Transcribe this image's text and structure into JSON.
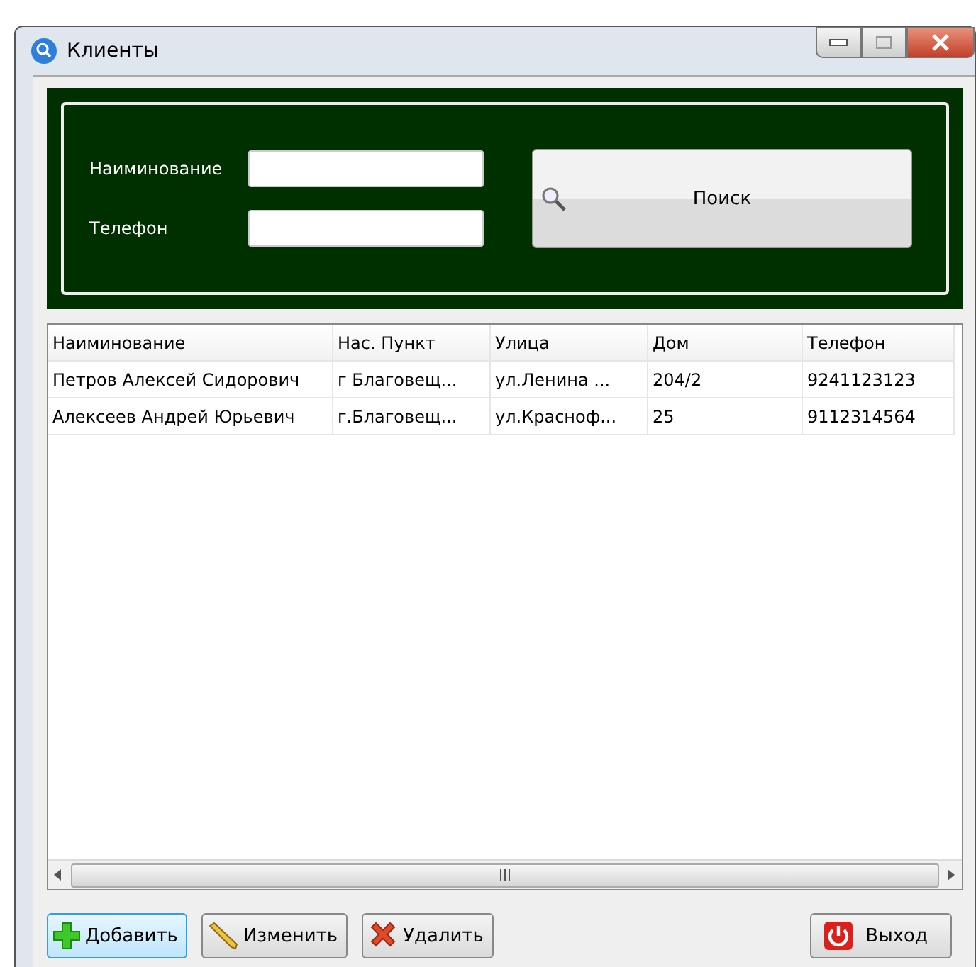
{
  "window": {
    "title": "Клиенты"
  },
  "search": {
    "fields": [
      {
        "label": "Наиминование"
      },
      {
        "label": "Телефон"
      }
    ],
    "button": "Поиск"
  },
  "table": {
    "columns": [
      "Наиминование",
      "Нас. Пункт",
      "Улица",
      "Дом",
      "Телефон"
    ],
    "rows": [
      [
        "Петров Алексей Сидорович",
        "г Благовещ...",
        "ул.Ленина   ...",
        "204/2",
        "9241123123"
      ],
      [
        "Алексеев Андрей Юрьевич",
        "г.Благовещ...",
        "ул.Красноф...",
        "25",
        "9112314564"
      ]
    ]
  },
  "buttons": [
    {
      "kind": "add",
      "label": "Добавить",
      "selected": true
    },
    {
      "kind": "edit",
      "label": "Изменить",
      "selected": false
    },
    {
      "kind": "delete",
      "label": "Удалить",
      "selected": false
    },
    {
      "kind": "exit",
      "label": "Выход",
      "selected": false
    }
  ]
}
